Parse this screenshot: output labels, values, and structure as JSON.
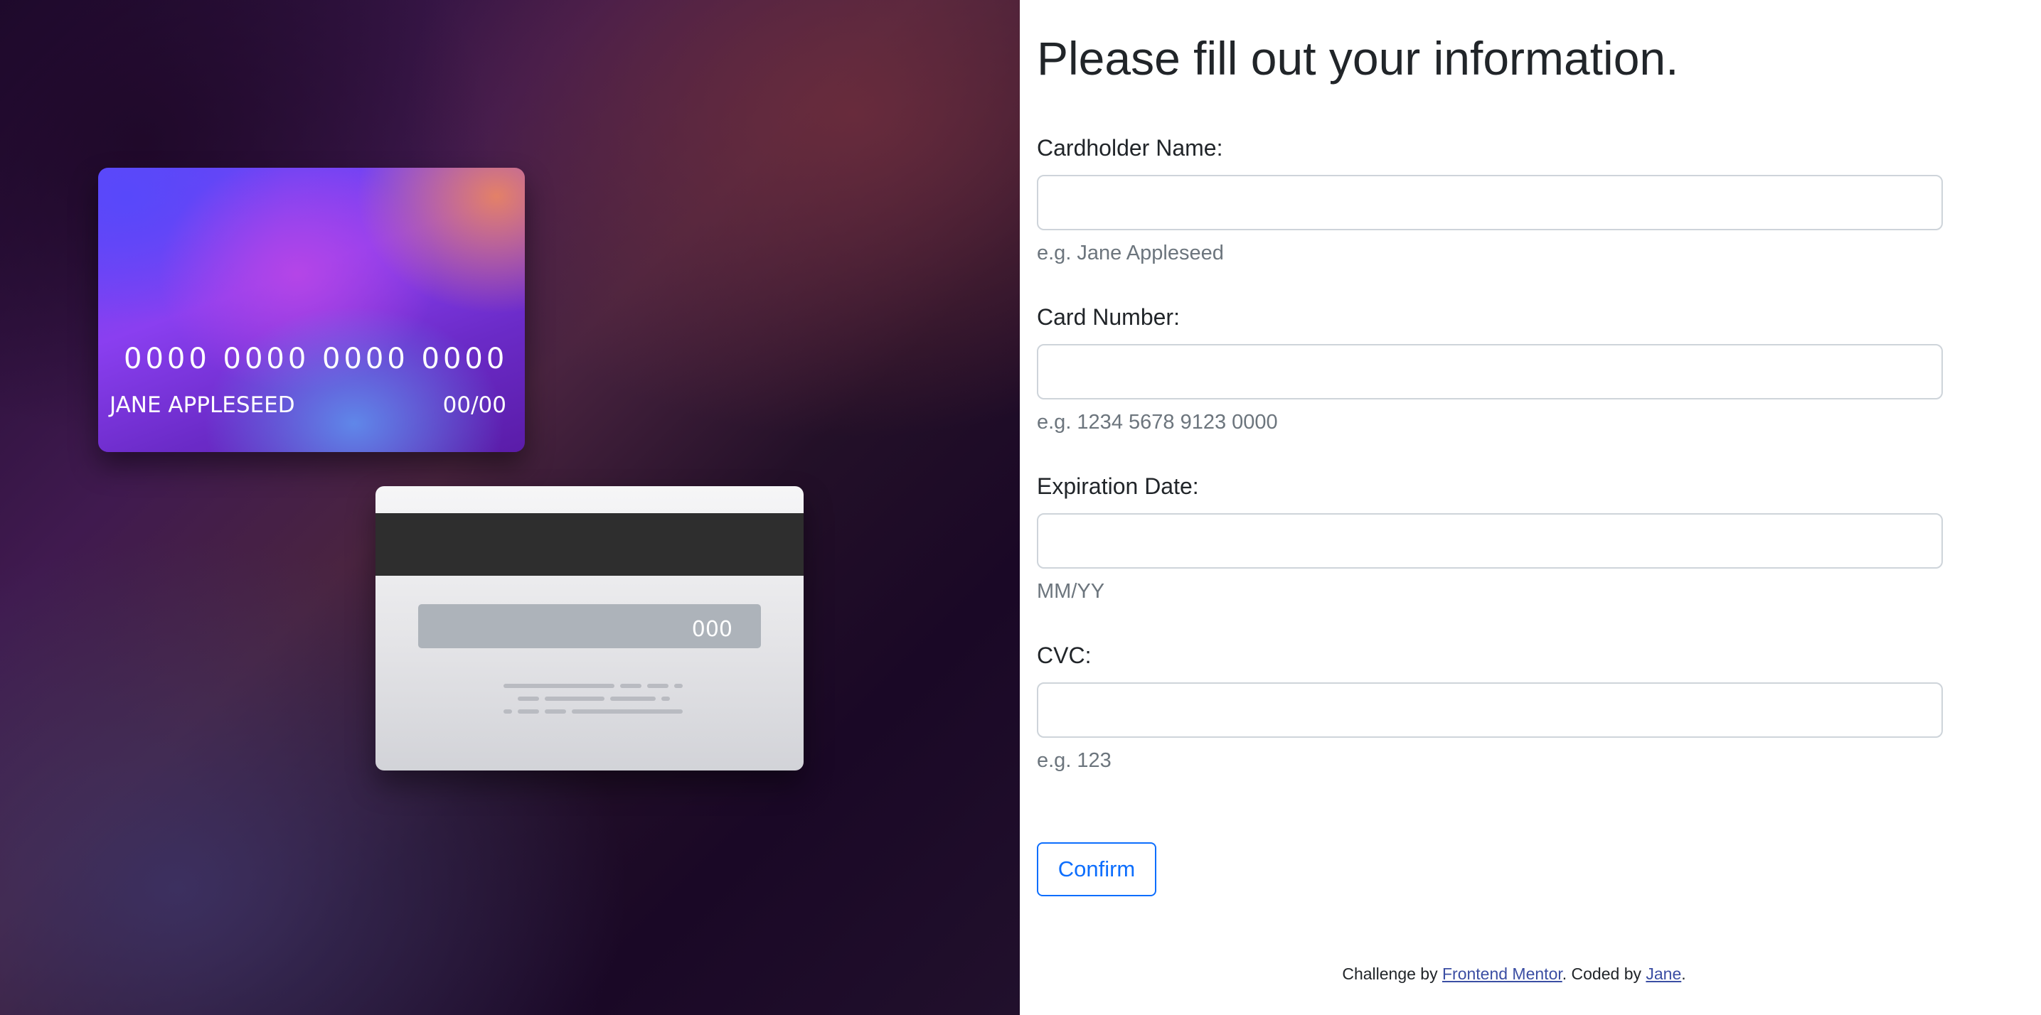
{
  "card_front": {
    "number": "0000 0000 0000 0000",
    "name": "JANE APPLESEED",
    "expiry": "00/00"
  },
  "card_back": {
    "cvc": "000"
  },
  "form": {
    "title": "Please fill out your information.",
    "fields": [
      {
        "label": "Cardholder Name:",
        "value": "",
        "hint": "e.g. Jane Appleseed"
      },
      {
        "label": "Card Number:",
        "value": "",
        "hint": "e.g. 1234 5678 9123 0000"
      },
      {
        "label": "Expiration Date:",
        "value": "",
        "hint": "MM/YY"
      },
      {
        "label": "CVC:",
        "value": "",
        "hint": "e.g. 123"
      }
    ],
    "confirm_label": "Confirm"
  },
  "footer": {
    "challenge_prefix": "Challenge by ",
    "challenge_link": "Frontend Mentor",
    "coded_prefix": ". Coded by ",
    "coded_link": "Jane",
    "suffix": "."
  },
  "colors": {
    "accent": "#0d6efd",
    "hint": "#6c757d",
    "input_border": "#ced4da"
  }
}
